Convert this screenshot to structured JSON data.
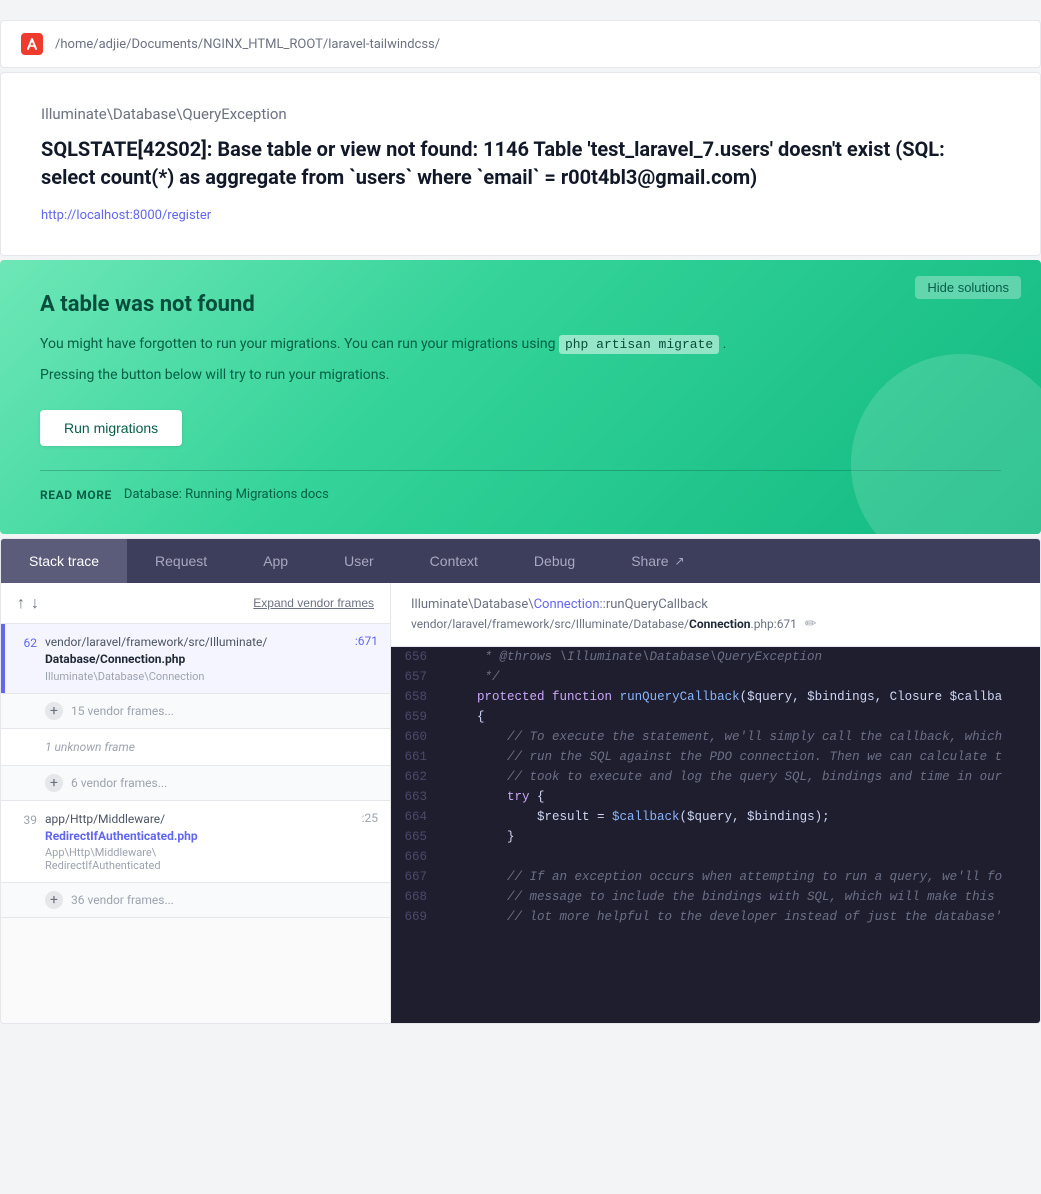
{
  "header": {
    "logo_alt": "Ignition logo",
    "path": "/home/adjie/Documents/NGINX_HTML_ROOT/laravel-tailwindcss/"
  },
  "error": {
    "exception_class": "Illuminate\\Database\\QueryException",
    "message": "SQLSTATE[42S02]: Base table or view not found: 1146 Table 'test_laravel_7.users' doesn't exist (SQL: select count(*) as aggregate from `users` where `email` = r00t4bl3@gmail.com)",
    "url": "http://localhost:8000/register"
  },
  "solution": {
    "hide_btn": "Hide solutions",
    "title": "A table was not found",
    "description_1": "You might have forgotten to run your migrations. You can run your migrations using",
    "command": "php artisan migrate",
    "description_2": ".",
    "description_3": "Pressing the button below will try to run your migrations.",
    "run_btn": "Run migrations",
    "read_more_label": "READ MORE",
    "read_more_link": "Database: Running Migrations docs"
  },
  "tabs": [
    {
      "id": "stack-trace",
      "label": "Stack trace",
      "active": true
    },
    {
      "id": "request",
      "label": "Request",
      "active": false
    },
    {
      "id": "app",
      "label": "App",
      "active": false
    },
    {
      "id": "user",
      "label": "User",
      "active": false
    },
    {
      "id": "context",
      "label": "Context",
      "active": false
    },
    {
      "id": "debug",
      "label": "Debug",
      "active": false
    },
    {
      "id": "share",
      "label": "Share",
      "active": false,
      "icon": "↗"
    }
  ],
  "frames_toolbar": {
    "expand_vendor": "Expand vendor frames"
  },
  "active_frame": {
    "class_path": "Illuminate\\Database\\Connection::runQueryCallback",
    "file_path": "vendor/laravel/framework/src/Illuminate/Database/",
    "file_name": "Connection",
    "file_ext": ".php:671"
  },
  "frames": [
    {
      "number": "62",
      "file_prefix": "vendor/laravel/framework/src/Illuminate/",
      "file_bold": "Database/Connection.php",
      "class": "Illuminate\\Database\\Connection",
      "line": ":671",
      "active": true,
      "type": "frame"
    }
  ],
  "vendor_groups": [
    {
      "label": "15 vendor frames...",
      "type": "vendor"
    },
    {
      "label": "1 unknown frame",
      "type": "unknown"
    },
    {
      "label": "6 vendor frames...",
      "type": "vendor"
    }
  ],
  "frame_39": {
    "number": "39",
    "file_prefix": "app/Http/Middleware/",
    "file_bold": "RedirectIfAuthenticated.php",
    "class": "App\\Http\\Middleware\\RedirectIfAuthenticated",
    "line": ":25",
    "type": "frame"
  },
  "frame_bottom_vendor": {
    "label": "36 vendor frames...",
    "type": "vendor"
  },
  "code_lines": [
    {
      "num": "656",
      "code": "     * @throws \\Illuminate\\Database\\QueryException",
      "type": "comment"
    },
    {
      "num": "657",
      "code": "     */",
      "type": "comment"
    },
    {
      "num": "658",
      "code": "    protected function runQueryCallback($query, $bindings, Closure $callba",
      "type": "code",
      "highlighted": false
    },
    {
      "num": "659",
      "code": "    {",
      "type": "code"
    },
    {
      "num": "660",
      "code": "        // To execute the statement, we'll simply call the callback, which",
      "type": "comment"
    },
    {
      "num": "661",
      "code": "        // run the SQL against the PDO connection. Then we can calculate t",
      "type": "comment"
    },
    {
      "num": "662",
      "code": "        // took to execute and log the query SQL, bindings and time in our",
      "type": "comment"
    },
    {
      "num": "663",
      "code": "        try {",
      "type": "code"
    },
    {
      "num": "664",
      "code": "            $result = $callback($query, $bindings);",
      "type": "code"
    },
    {
      "num": "665",
      "code": "        }",
      "type": "code"
    },
    {
      "num": "666",
      "code": "",
      "type": "code"
    },
    {
      "num": "667",
      "code": "        // If an exception occurs when attempting to run a query, we'll fo",
      "type": "comment"
    },
    {
      "num": "668",
      "code": "        // message to include the bindings with SQL, which will make this",
      "type": "comment"
    },
    {
      "num": "669",
      "code": "        // lot more helpful to the developer instead of just the database'",
      "type": "comment"
    }
  ]
}
